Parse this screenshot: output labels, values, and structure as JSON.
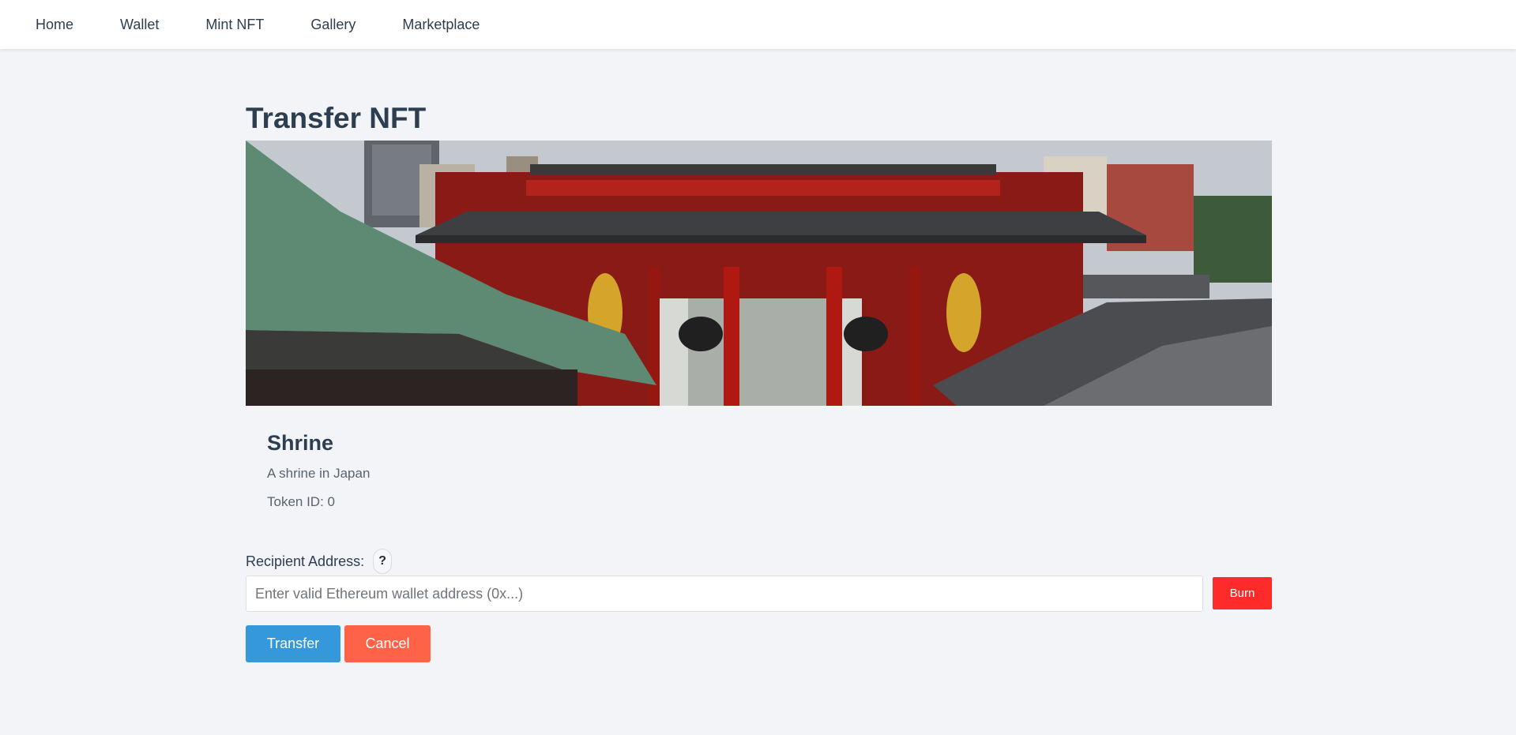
{
  "nav": {
    "items": [
      {
        "label": "Home"
      },
      {
        "label": "Wallet"
      },
      {
        "label": "Mint NFT"
      },
      {
        "label": "Gallery"
      },
      {
        "label": "Marketplace"
      }
    ]
  },
  "page": {
    "title": "Transfer NFT"
  },
  "nft": {
    "image_icon": "shrine-photo",
    "name": "Shrine",
    "description": "A shrine in Japan",
    "token_id_text": "Token ID: 0"
  },
  "form": {
    "recipient_label": "Recipient Address:",
    "help_label": "?",
    "address_placeholder": "Enter valid Ethereum wallet address (0x...)",
    "address_value": "",
    "burn_label": "Burn",
    "transfer_label": "Transfer",
    "cancel_label": "Cancel"
  },
  "colors": {
    "accent_blue": "#3498db",
    "cancel_orange": "#ff6347",
    "burn_red": "#ff2a2a",
    "text_dark": "#2c3e50",
    "page_background": "#f3f4f8"
  }
}
